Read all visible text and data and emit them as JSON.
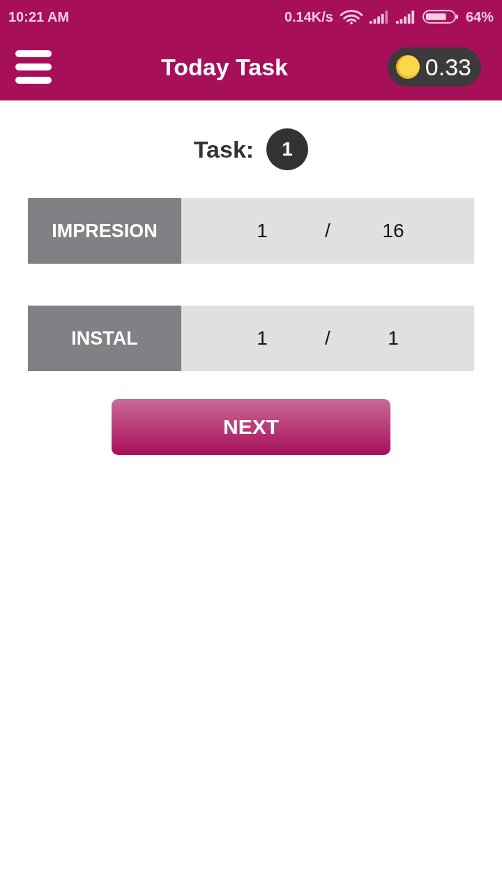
{
  "status_bar": {
    "time": "10:21 AM",
    "network_speed": "0.14K/s",
    "battery_percent": "64%"
  },
  "app_bar": {
    "title": "Today Task",
    "coin_balance": "0.33"
  },
  "task": {
    "label": "Task:",
    "number": "1"
  },
  "counters": [
    {
      "label": "IMPRESION",
      "done": "1",
      "separator": "/",
      "total": "16"
    },
    {
      "label": "INSTAL",
      "done": "1",
      "separator": "/",
      "total": "1"
    }
  ],
  "next_button": {
    "label": "NEXT"
  }
}
